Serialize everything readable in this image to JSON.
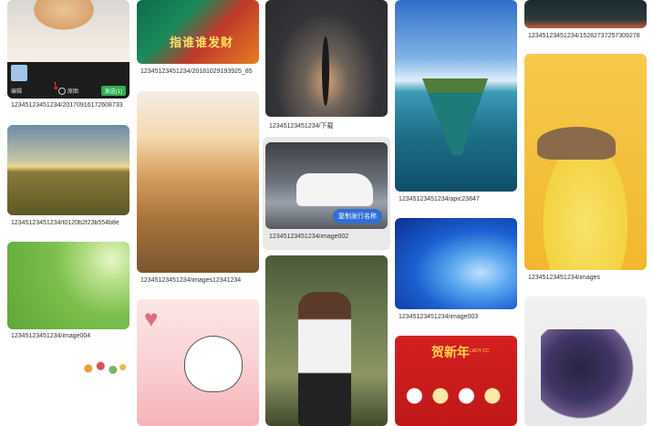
{
  "columns": [
    {
      "items": [
        {
          "caption": "12345123451234/20170916172608733",
          "bar": {
            "edit": "编辑",
            "restore": "原图",
            "send": "发送(1)"
          }
        },
        {
          "caption": "12345123451234/t0120b2f23b554b8e"
        },
        {
          "caption": "12345123451234/image004"
        },
        {
          "caption": ""
        }
      ]
    },
    {
      "items": [
        {
          "caption": "12345123451234/20181029193925_85"
        },
        {
          "caption": "12345123451234/images12341234"
        },
        {
          "caption": ""
        }
      ]
    },
    {
      "items": [
        {
          "caption": "12345123451234/下载"
        },
        {
          "caption": "12345123451234/image002",
          "action": "复制发行名称"
        },
        {
          "caption": ""
        }
      ]
    },
    {
      "items": [
        {
          "caption": "12345123451234/apic23847"
        },
        {
          "caption": "12345123451234/image003"
        },
        {
          "caption": ""
        }
      ]
    },
    {
      "items": [
        {
          "caption": "12345123451234/15282737257309278"
        },
        {
          "caption": "12345123451234/images"
        },
        {
          "caption": ""
        }
      ]
    }
  ],
  "poster_text": {
    "banner": "指谁谁发财",
    "new_year": "贺新年",
    "new_year_sub": "LADY CC"
  }
}
